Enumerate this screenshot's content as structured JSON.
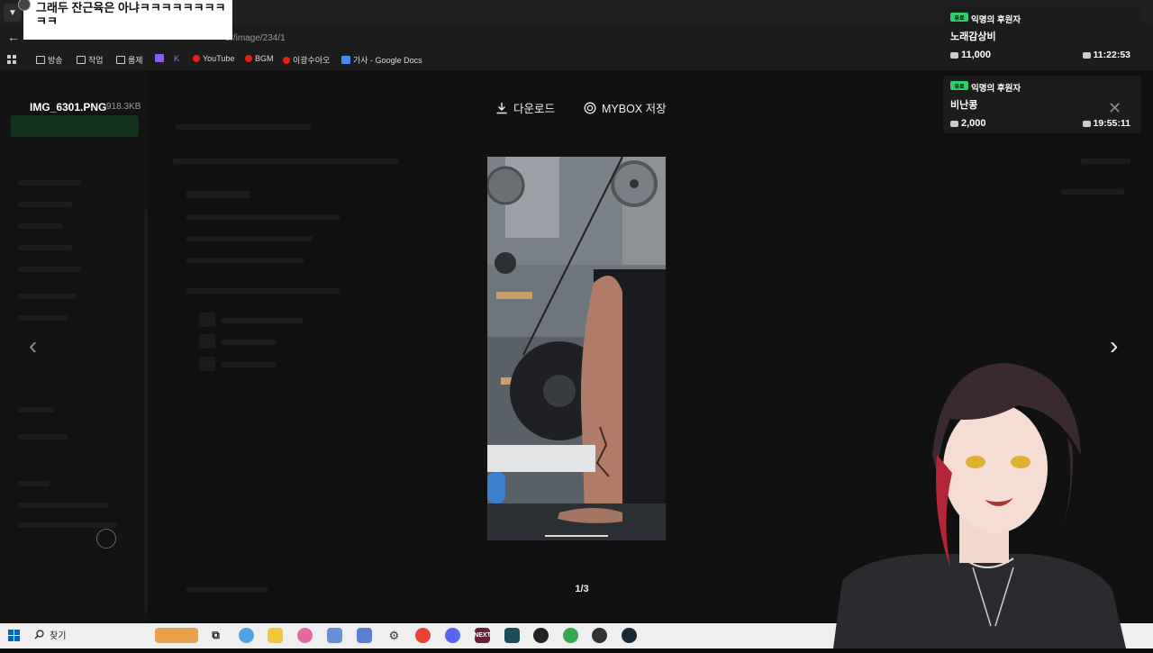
{
  "chat": {
    "message": "그래두 잔근육은 아냐ㅋㅋㅋㅋㅋㅋㅋㅋㅋㅋ"
  },
  "browser": {
    "url_suffix": "er/image/234/1",
    "bookmarks": [
      {
        "label": "방송",
        "icon": "folder-icon"
      },
      {
        "label": "작업",
        "icon": "folder-icon"
      },
      {
        "label": "룸제",
        "icon": "folder-icon"
      },
      {
        "label": "K",
        "icon": "k-icon"
      },
      {
        "label": "YouTube",
        "icon": "youtube-icon"
      },
      {
        "label": "BGM",
        "icon": "youtube-icon"
      },
      {
        "label": "이광수아오",
        "icon": "youtube-icon"
      },
      {
        "label": "가사 - Google Docs",
        "icon": "docs-icon"
      }
    ]
  },
  "viewer": {
    "filename": "IMG_6301.PNG",
    "filesize": "918.3KB",
    "download_label": "다운로드",
    "mybox_label": "MYBOX 저장",
    "page_counter": "1/3"
  },
  "donations": [
    {
      "badge": "유료",
      "title": "익명의 후원자",
      "name": "노래감상비",
      "amount": "11,000",
      "time": "11:22:53"
    },
    {
      "badge": "유료",
      "title": "익명의 후원자",
      "name": "비난콩",
      "amount": "2,000",
      "time": "19:55:11"
    }
  ],
  "taskbar": {
    "search_label": "찾기",
    "apps": [
      "widgets",
      "task-view",
      "copilot",
      "file-explorer",
      "app-1",
      "app-2",
      "app-3",
      "settings",
      "chrome",
      "discord",
      "next-app",
      "app-4",
      "obs",
      "chrome-2",
      "app-5",
      "steam"
    ]
  },
  "colors": {
    "accent_green": "#2fd06b",
    "backdrop": "#0b0b0b",
    "taskbar": "#efefef"
  }
}
